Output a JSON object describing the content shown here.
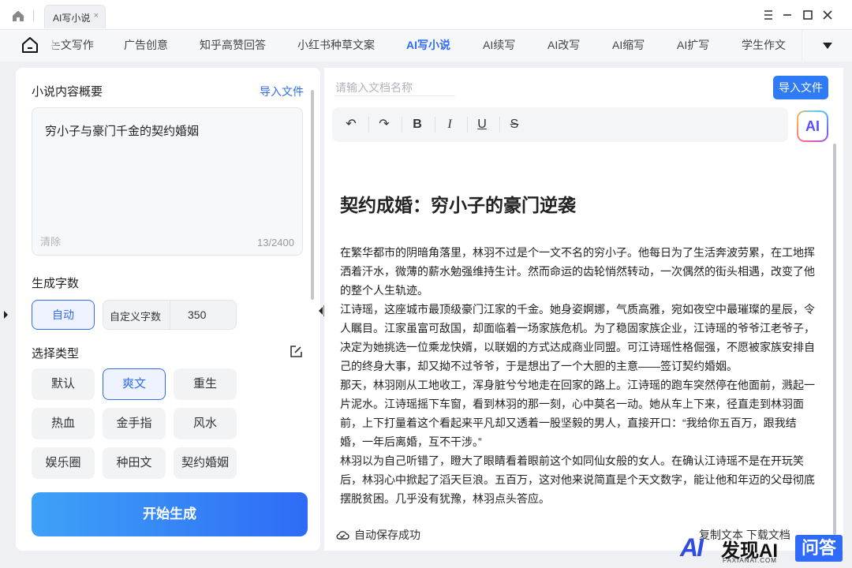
{
  "window": {
    "tab_title": "AI写小说",
    "tab_close": "×"
  },
  "nav": {
    "items": [
      {
        "label": "논文写作"
      },
      {
        "label": "广告创意"
      },
      {
        "label": "知乎高赞回答"
      },
      {
        "label": "小红书种草文案"
      },
      {
        "label": "AI写小说",
        "active": true
      },
      {
        "label": "AI续写"
      },
      {
        "label": "AI改写"
      },
      {
        "label": "AI缩写"
      },
      {
        "label": "AI扩写"
      },
      {
        "label": "学生作文"
      }
    ]
  },
  "left": {
    "summary_label": "小说内容概要",
    "import_link": "导入文件",
    "summary_text": "穷小子与豪门千金的契约婚姻",
    "clear": "清除",
    "char_count": "13/2400",
    "word_count_label": "生成字数",
    "auto_button": "自动",
    "custom_label": "自定义字数",
    "custom_value": "350",
    "type_label": "选择类型",
    "types": [
      "默认",
      "爽文",
      "重生",
      "热血",
      "金手指",
      "风水",
      "娱乐圈",
      "种田文",
      "契约婚姻"
    ],
    "selected_type": "爽文",
    "generate_button": "开始生成"
  },
  "editor": {
    "doc_name_placeholder": "请输入文档名称",
    "import_button": "导入文件",
    "toolbar": {
      "undo": "↶",
      "redo": "↷",
      "bold": "B",
      "italic": "I",
      "underline": "U",
      "strike": "S"
    },
    "ai_badge": "AI",
    "title": "契约成婚：穷小子的豪门逆袭",
    "paragraphs": [
      "在繁华都市的阴暗角落里，林羽不过是个一文不名的穷小子。他每日为了生活奔波劳累，在工地挥洒着汗水，微薄的薪水勉强维持生计。然而命运的齿轮悄然转动，一次偶然的街头相遇，改变了他的整个人生轨迹。",
      "江诗瑶，这座城市最顶级豪门江家的千金。她身姿婀娜，气质高雅，宛如夜空中最璀璨的星辰，令人瞩目。江家虽富可敌国，却面临着一场家族危机。为了稳固家族企业，江诗瑶的爷爷江老爷子，决定为她挑选一位乘龙快婿，以联姻的方式达成商业同盟。可江诗瑶性格倔强，不愿被家族安排自己的终身大事，却又拗不过爷爷，于是想出了一个大胆的主意——签订契约婚姻。",
      "那天，林羽刚从工地收工，浑身脏兮兮地走在回家的路上。江诗瑶的跑车突然停在他面前，溅起一片泥水。江诗瑶摇下车窗，看到林羽的那一刻，心中莫名一动。她从车上下来，径直走到林羽面前，上下打量着这个看起来平凡却又透着一股坚毅的男人，直接开口：“我给你五百万，跟我结婚，一年后离婚，互不干涉。”",
      "林羽以为自己听错了，瞪大了眼睛看着眼前这个如同仙女般的女人。在确认江诗瑶不是在开玩笑后，林羽心中掀起了滔天巨浪。五百万，这对他来说简直是个天文数字，能让他和年迈的父母彻底摆脱贫困。几乎没有犹豫，林羽点头答应。"
    ],
    "autosave": "自动保存成功",
    "footer_partial": "复制文本    下载文档"
  },
  "watermark": {
    "logo": "AI",
    "name": "发现AI",
    "sub": "FAXIANAI.COM",
    "qa": "问答"
  }
}
